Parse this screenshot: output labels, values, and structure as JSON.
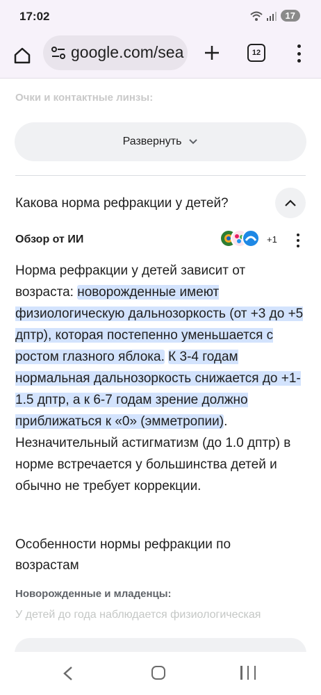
{
  "status_bar": {
    "time": "17:02",
    "battery": "17"
  },
  "browser": {
    "url": "google.com/sea",
    "tab_count": "12",
    "icons": [
      "home-icon",
      "tune-icon",
      "plus-icon",
      "tabs-icon",
      "more-vert-icon"
    ]
  },
  "content": {
    "faded_heading": "Очки и контактные линзы:",
    "expand_button": "Развернуть",
    "question": "Какова норма рефракции у детей?",
    "ai_overview_label": "Обзор от ИИ",
    "sources_more": "+1",
    "answer": {
      "part1": "Норма рефракции у детей зависит от возраста: ",
      "highlight1": "новорожденные имеют физиологическую дальнозоркость (от +3 до +5 дптр), которая постепенно уменьшается с ростом глазного яблока.",
      "space": " ",
      "highlight2": "К 3-4 годам нормальная дальнозоркость снижается до +1-1.5 дптр, а к 6-7 годам зрение должно приближаться к «0» (эмметропии)",
      "part2": ". Незначительный астигматизм (до 1.0 дптр) в норме встречается у большинства детей и обычно не требует коррекции."
    },
    "section_title": "Особенности нормы рефракции по возрастам",
    "subheading": "Новорожденные и младенцы:",
    "faded_text": "У детей до года наблюдается физиологическая"
  },
  "colors": {
    "highlight": "#d3e3fd",
    "chrome_bg": "#f7f2fa",
    "pill_bg": "#f0f1f3"
  }
}
